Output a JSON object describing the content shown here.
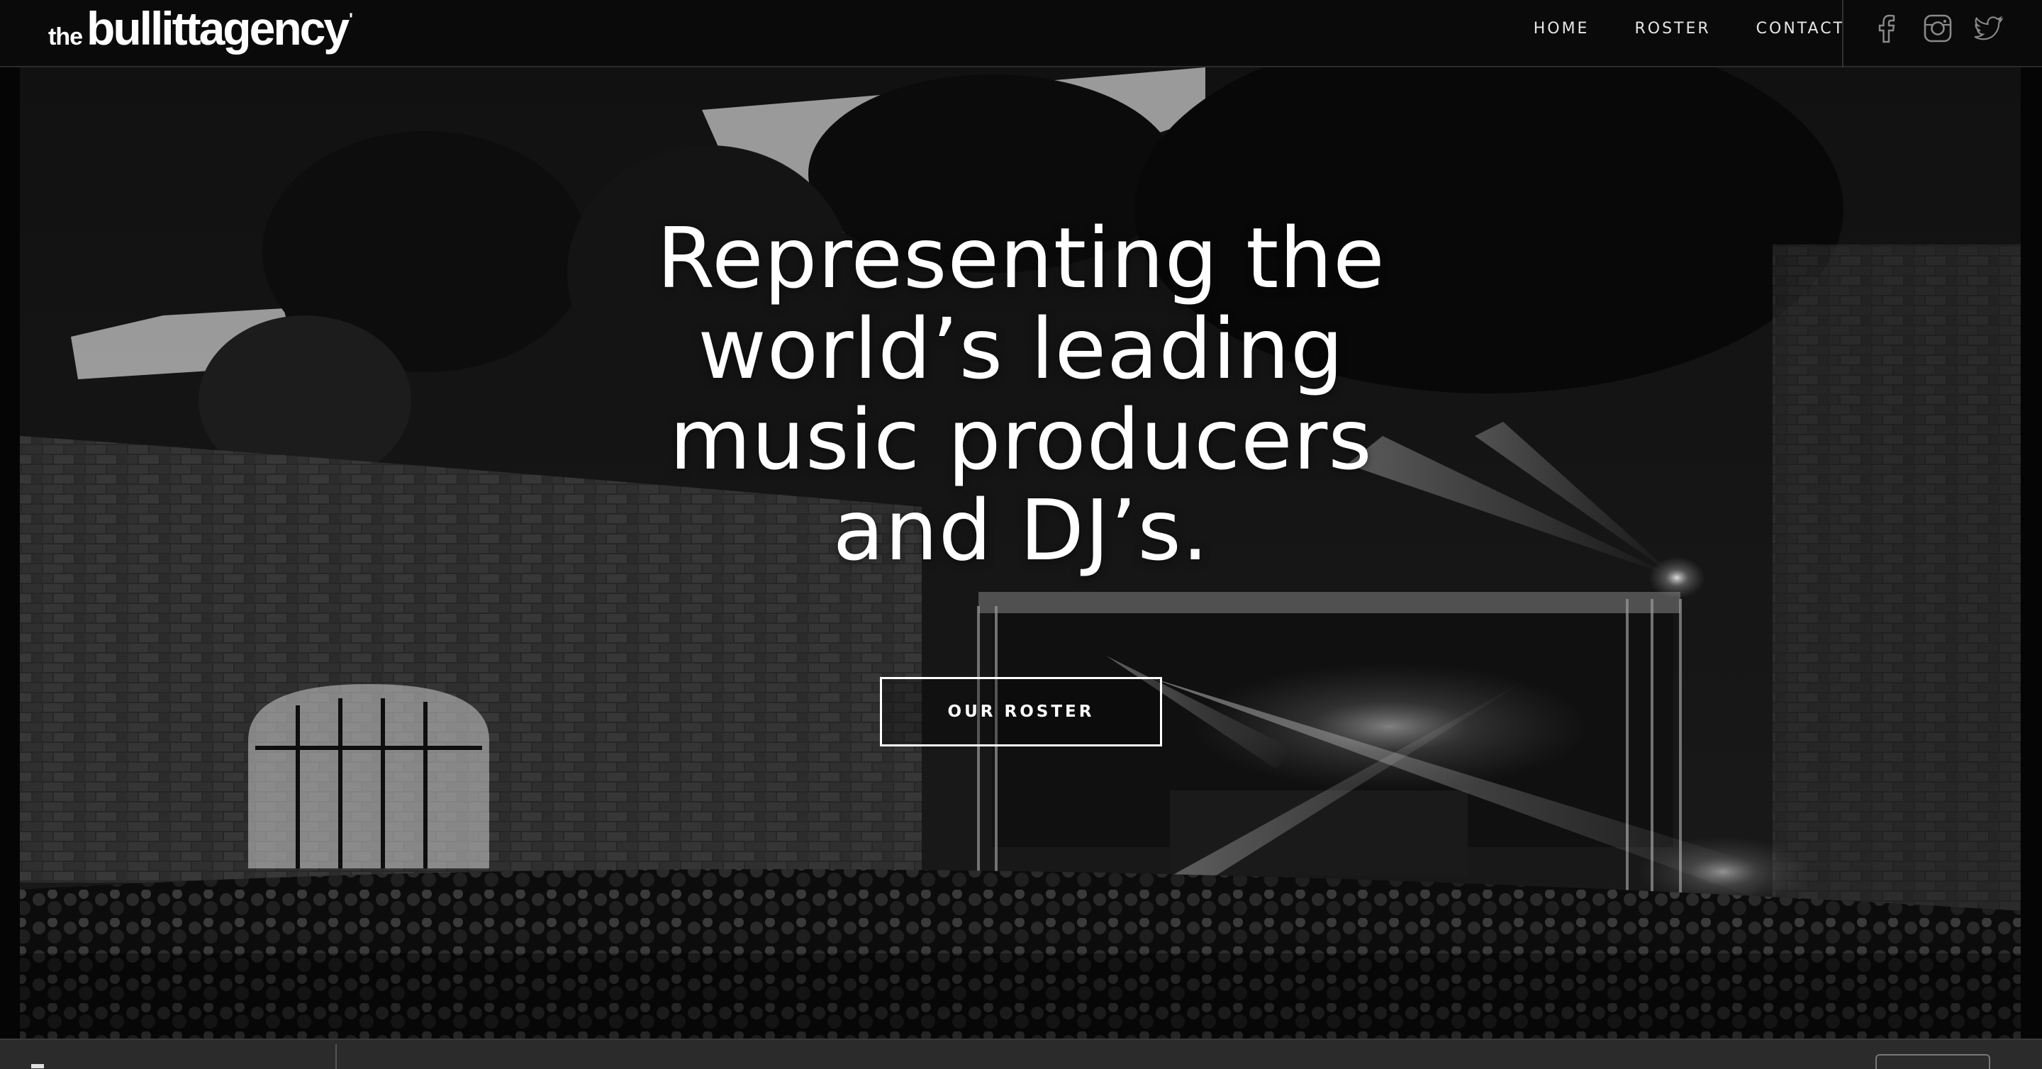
{
  "brand": {
    "prefix": "the",
    "name": "bullittagency",
    "mark": "'"
  },
  "nav": {
    "items": [
      {
        "label": "HOME"
      },
      {
        "label": "ROSTER"
      },
      {
        "label": "CONTACT"
      }
    ]
  },
  "social": {
    "icons": [
      "facebook-icon",
      "instagram-icon",
      "twitter-icon"
    ]
  },
  "hero": {
    "headline_lines": [
      "Representing the",
      "world’s leading",
      "music producers",
      "and DJ’s."
    ],
    "cta_label": "OUR ROSTER"
  },
  "colors": {
    "background": "#0a0a0a",
    "text": "#ffffff",
    "nav_text": "#e6e6e6",
    "bottom_bar": "#2b2b2b"
  }
}
